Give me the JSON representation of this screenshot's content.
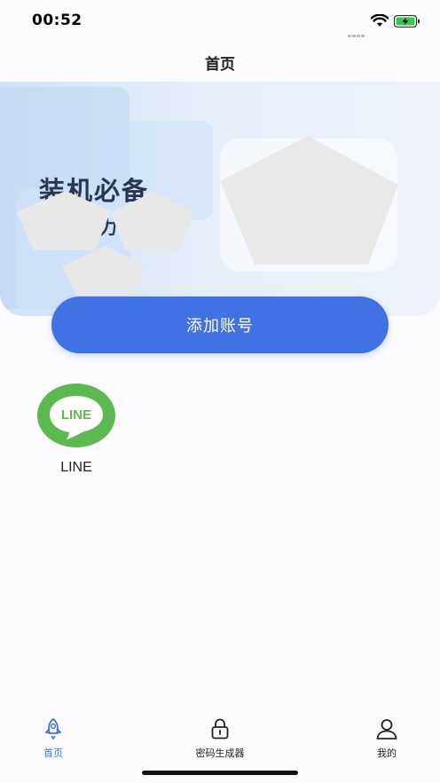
{
  "status_bar": {
    "time": "00:52",
    "icons": [
      "signal-icon",
      "wifi-icon",
      "battery-charging-icon"
    ]
  },
  "nav": {
    "title": "首页"
  },
  "banner": {
    "title": "装机必备",
    "subtitle": "主力"
  },
  "add_account_button": "添加账号",
  "apps": [
    {
      "label": "LINE",
      "icon_text": "LINE",
      "icon": "line-app-icon"
    }
  ],
  "tab_bar": {
    "items": [
      {
        "label": "首页",
        "icon": "rocket-icon",
        "active": true
      },
      {
        "label": "密码生成器",
        "icon": "lock-icon",
        "active": false
      },
      {
        "label": "我的",
        "icon": "person-icon",
        "active": false
      }
    ]
  },
  "colors": {
    "accent": "#3f73e3",
    "line_green": "#5bb94f",
    "battery": "#38c84a"
  }
}
